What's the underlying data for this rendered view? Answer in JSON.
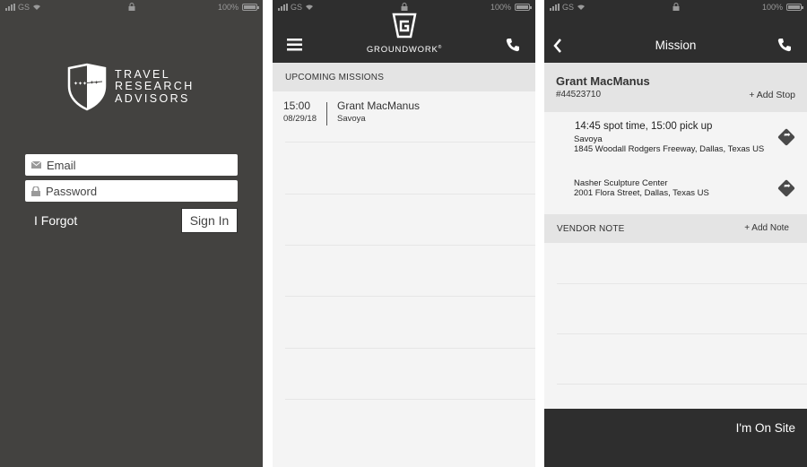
{
  "status_bar": {
    "carrier": "GS",
    "battery": "100%"
  },
  "login": {
    "logo_lines": [
      "TRAVEL",
      "RESEARCH",
      "ADVISORS"
    ],
    "email_placeholder": "Email",
    "password_placeholder": "Password",
    "forgot_label": "I Forgot",
    "signin_label": "Sign In"
  },
  "missions_screen": {
    "brand_name": "GROUNDWORK",
    "brand_mark": "®",
    "section_header": "UPCOMING MISSIONS",
    "missions": [
      {
        "time": "15:00",
        "date": "08/29/18",
        "client": "Grant MacManus",
        "venue": "Savoya"
      }
    ]
  },
  "mission_detail": {
    "title": "Mission",
    "client_name": "Grant MacManus",
    "mission_id": "#44523710",
    "add_stop_label": "+ Add Stop",
    "timing": "14:45 spot time, 15:00 pick up",
    "stops": [
      {
        "name": "Savoya",
        "address": "1845 Woodall Rodgers Freeway, Dallas, Texas US"
      },
      {
        "name": "Nasher Sculpture Center",
        "address": "2001 Flora Street, Dallas, Texas US"
      }
    ],
    "vendor_note_header": "VENDOR NOTE",
    "add_note_label": "+ Add Note",
    "onsite_label": "I'm On Site"
  },
  "colors": {
    "login_bg": "#434240",
    "header_bg": "#2e2e2e",
    "list_bg": "#f4f4f4",
    "section_bg": "#e4e4e4"
  }
}
